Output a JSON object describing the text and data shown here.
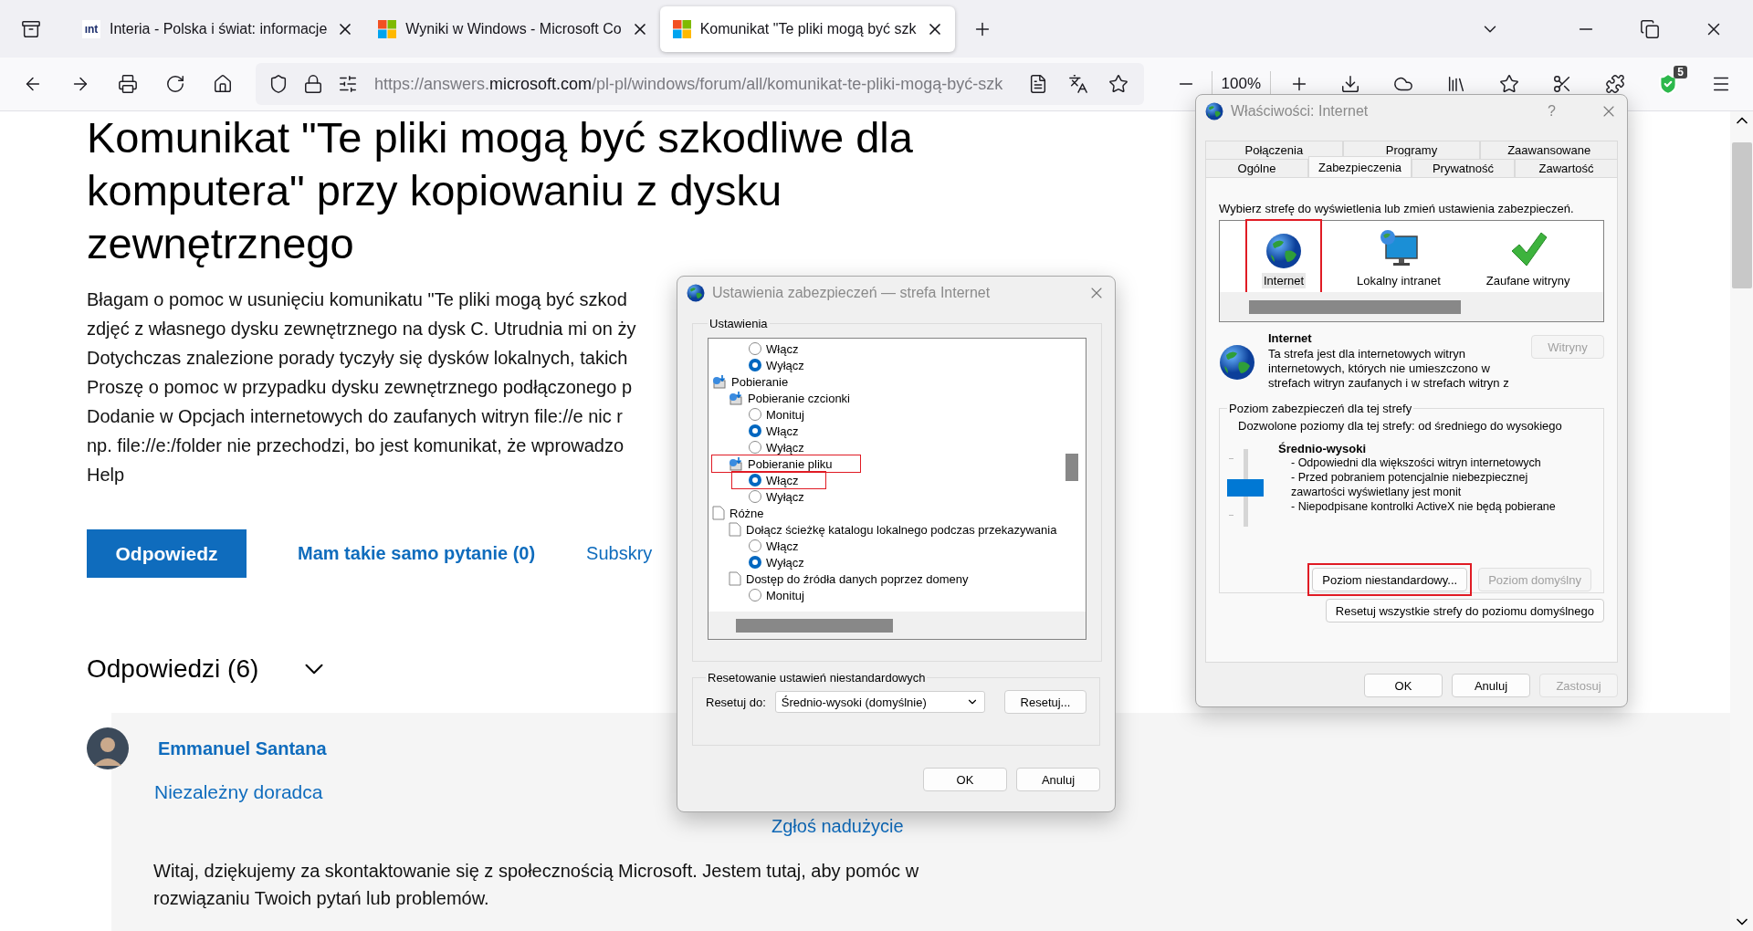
{
  "browser": {
    "tabs": [
      {
        "favicon_text": "ınt",
        "title": "Interia - Polska i świat: informacje",
        "selected": false
      },
      {
        "title": "Wyniki w Windows - Microsoft Co",
        "selected": false
      },
      {
        "title": "Komunikat \"Te pliki mogą być szk",
        "selected": true
      }
    ],
    "url": {
      "prefix": "https://answers.",
      "domain": "microsoft.com",
      "path": "/pl-pl/windows/forum/all/komunikat-te-pliki-mogą-być-szk"
    },
    "zoom": "100%",
    "extension_badge": "5"
  },
  "page": {
    "title": "Komunikat \"Te pliki mogą być szkodliwe dla komputera\" przy kopiowaniu z dysku zewnętrznego",
    "question_lines": [
      "Błagam o pomoc w usunięciu komunikatu \"Te pliki mogą być szkod",
      "zdjęć z własnego dysku zewnętrznego na dysk C. Utrudnia mi on ży",
      "Dotychczas znalezione porady tyczyły się dysków lokalnych, takich",
      "Proszę o pomoc w przypadku dysku zewnętrznego podłączonego p",
      "Dodanie w Opcjach internetowych do zaufanych witryn file://e nic r",
      "np. file://e:/folder nie przechodzi, bo jest komunikat, że wprowadzo",
      "Help"
    ],
    "reply_button": "Odpowiedz",
    "same_question_link": "Mam takie samo pytanie (0)",
    "subscribe_link": "Subskry",
    "answers_heading": "Odpowiedzi (6)",
    "answer": {
      "author": "Emmanuel Santana",
      "role": "Niezależny doradca",
      "report_link": "Zgłoś nadużycie",
      "text": "Witaj, dziękujemy za skontaktowanie się z społecznością Microsoft. Jestem tutaj, aby pomóc w rozwiązaniu Twoich pytań lub problemów."
    }
  },
  "security_settings_dialog": {
    "title": "Ustawienia zabezpieczeń — strefa Internet",
    "settings_label": "Ustawienia",
    "tree": [
      {
        "kind": "radio",
        "label": "Włącz",
        "checked": false,
        "marked": false
      },
      {
        "kind": "radio",
        "label": "Wyłącz",
        "checked": true,
        "marked": false
      },
      {
        "kind": "download",
        "label": "Pobieranie",
        "marked": false,
        "children": [
          {
            "kind": "download",
            "label": "Pobieranie czcionki",
            "marked": false,
            "children": [
              {
                "kind": "radio",
                "label": "Monituj",
                "checked": false,
                "marked": false
              },
              {
                "kind": "radio",
                "label": "Włącz",
                "checked": true,
                "marked": false
              },
              {
                "kind": "radio",
                "label": "Wyłącz",
                "checked": false,
                "marked": false
              }
            ]
          },
          {
            "kind": "download",
            "label": "Pobieranie pliku",
            "marked": true,
            "children": [
              {
                "kind": "radio",
                "label": "Włącz",
                "checked": true,
                "marked": true
              },
              {
                "kind": "radio",
                "label": "Wyłącz",
                "checked": false,
                "marked": false
              }
            ]
          }
        ]
      },
      {
        "kind": "page",
        "label": "Różne",
        "marked": false,
        "children": [
          {
            "kind": "page",
            "label": "Dołącz ścieżkę katalogu lokalnego podczas przekazywania",
            "marked": false,
            "children": [
              {
                "kind": "radio",
                "label": "Włącz",
                "checked": false,
                "marked": false
              },
              {
                "kind": "radio",
                "label": "Wyłącz",
                "checked": true,
                "marked": false
              }
            ]
          },
          {
            "kind": "page",
            "label": "Dostęp do źródła danych poprzez domeny",
            "marked": false,
            "children": [
              {
                "kind": "radio",
                "label": "Monituj",
                "checked": false,
                "marked": false
              }
            ]
          }
        ]
      }
    ],
    "reset_group_label": "Resetowanie ustawień niestandardowych",
    "reset_to_label": "Resetuj do:",
    "reset_to_value": "Średnio-wysoki (domyślnie)",
    "reset_button": "Resetuj...",
    "ok_button": "OK",
    "cancel_button": "Anuluj"
  },
  "internet_options_dialog": {
    "title": "Właściwości: Internet",
    "help": "?",
    "tab_rows": [
      {
        "tabs": [
          {
            "label": "Połączenia",
            "selected": false
          },
          {
            "label": "Programy",
            "selected": false
          },
          {
            "label": "Zaawansowane",
            "selected": false
          }
        ]
      },
      {
        "tabs": [
          {
            "label": "Ogólne",
            "selected": false
          },
          {
            "label": "Zabezpieczenia",
            "selected": true
          },
          {
            "label": "Prywatność",
            "selected": false
          },
          {
            "label": "Zawartość",
            "selected": false
          }
        ]
      }
    ],
    "zone_prompt": "Wybierz strefę do wyświetlenia lub zmień ustawienia zabezpieczeń.",
    "zones": [
      {
        "kind": "globe",
        "label": "Internet",
        "selected": true,
        "marked": true
      },
      {
        "kind": "monitor",
        "label": "Lokalny intranet",
        "selected": false,
        "marked": false
      },
      {
        "kind": "check",
        "label": "Zaufane witryny",
        "selected": false,
        "marked": false
      }
    ],
    "zone_name": "Internet",
    "zone_description_lines": [
      "Ta strefa jest dla internetowych witryn",
      "internetowych, których nie umieszczono w",
      "strefach witryn zaufanych i w strefach witryn z"
    ],
    "sites_button": {
      "label": "Witryny",
      "disabled": true
    },
    "level_group_label": "Poziom zabezpieczeń dla tej strefy",
    "allowed_levels": "Dozwolone poziomy dla tej strefy: od średniego do wysokiego",
    "level": 0.5,
    "level_name": "Średnio-wysoki",
    "level_points": [
      "- Odpowiedni dla większości witryn internetowych",
      "- Przed pobraniem potencjalnie niebezpiecznej zawartości wyświetlany jest monit",
      "- Niepodpisane kontrolki ActiveX nie będą pobierane"
    ],
    "custom_level_button": {
      "label": "Poziom niestandardowy...",
      "disabled": false,
      "marked": true
    },
    "default_level_button": {
      "label": "Poziom domyślny",
      "disabled": true
    },
    "reset_all_button": "Resetuj wszystkie strefy do poziomu domyślnego",
    "footer_buttons": [
      {
        "label": "OK",
        "disabled": false
      },
      {
        "label": "Anuluj",
        "disabled": false
      },
      {
        "label": "Zastosuj",
        "disabled": true
      }
    ]
  }
}
